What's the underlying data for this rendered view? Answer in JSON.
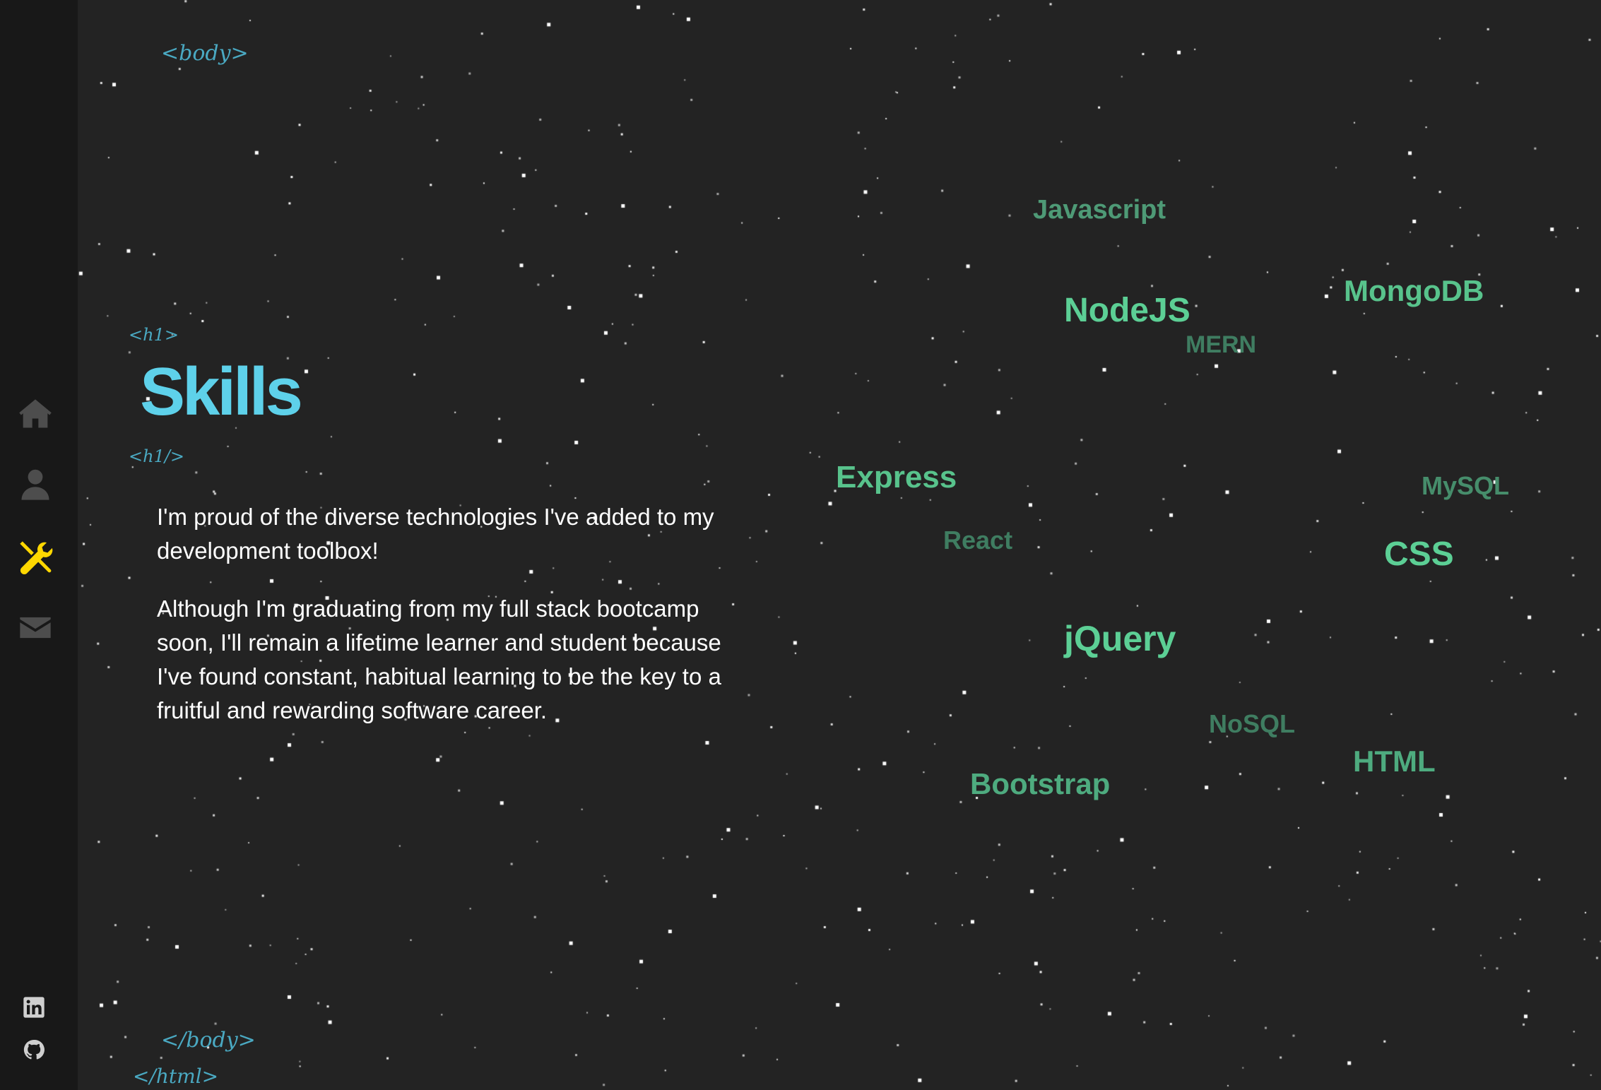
{
  "tags": {
    "body_open": "<body>",
    "h1_open": "<h1>",
    "h1_close": "<h1/>",
    "body_close": "</body>",
    "html_close": "</html>"
  },
  "title": "Skills",
  "paragraphs": [
    "I'm proud of the diverse technologies I've added to my development toolbox!",
    "Although I'm graduating from my full stack bootcamp soon, I'll remain a lifetime learner and student because I've found constant, habitual learning to be the key to a fruitful and rewarding software career."
  ],
  "nav": [
    {
      "name": "home",
      "icon": "home-icon",
      "active": false
    },
    {
      "name": "about",
      "icon": "user-icon",
      "active": false
    },
    {
      "name": "skills",
      "icon": "tools-icon",
      "active": true
    },
    {
      "name": "contact",
      "icon": "envelope-icon",
      "active": false
    }
  ],
  "social": [
    {
      "name": "linkedin",
      "icon": "linkedin-icon"
    },
    {
      "name": "github",
      "icon": "github-icon"
    }
  ],
  "skills": [
    {
      "label": "Javascript",
      "color": "#4e9a76"
    },
    {
      "label": "NodeJS",
      "color": "#5ccf95"
    },
    {
      "label": "MongoDB",
      "color": "#58c38c"
    },
    {
      "label": "MERN",
      "color": "#3f7d61"
    },
    {
      "label": "Express",
      "color": "#58c38c"
    },
    {
      "label": "MySQL",
      "color": "#468d6b"
    },
    {
      "label": "React",
      "color": "#3f7d61"
    },
    {
      "label": "CSS",
      "color": "#5ccf95"
    },
    {
      "label": "jQuery",
      "color": "#5ccf95"
    },
    {
      "label": "NoSQL",
      "color": "#3f7d61"
    },
    {
      "label": "HTML",
      "color": "#4eab7f"
    },
    {
      "label": "Bootstrap",
      "color": "#4eab7f"
    }
  ],
  "colors": {
    "background": "#232323",
    "sidebar": "#181818",
    "title": "#5ed1ea",
    "tag": "#4aa9c2",
    "nav_icon": "#4d4d4d",
    "nav_active": "#ffd700"
  }
}
